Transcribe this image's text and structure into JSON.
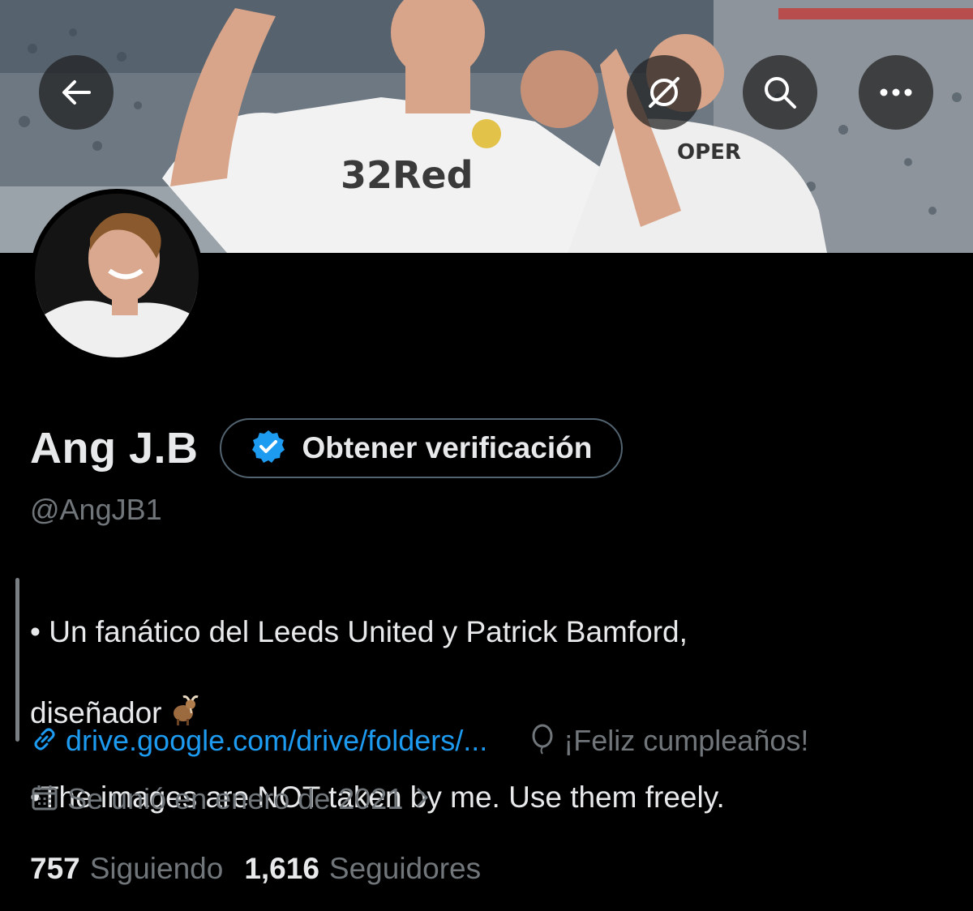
{
  "header": {
    "back_icon": "arrow-left-icon",
    "translate_icon": "no-signal-icon",
    "search_icon": "search-icon",
    "more_icon": "more-horizontal-icon"
  },
  "banner": {
    "sponsor_text": "32Red",
    "jersey_text": "OPER"
  },
  "profile": {
    "display_name": "Ang J.B",
    "verify_label": "Obtener verificación",
    "handle": "@AngJB1",
    "bio_line1": "• Un fanático del Leeds United y Patrick Bamford,",
    "bio_line2": "diseñador",
    "bio_line3": "•The images are NOT taken by me. Use them freely.",
    "link": "drive.google.com/drive/folders/...",
    "birthday": "¡Feliz cumpleaños!",
    "joined": "Se unió en enero de 2021"
  },
  "stats": {
    "following_count": "757",
    "following_label": "Siguiendo",
    "followers_count": "1,616",
    "followers_label": "Seguidores"
  },
  "colors": {
    "background": "#000000",
    "accent": "#1d9bf0",
    "muted": "#71767b",
    "text": "#e7e9ea"
  }
}
